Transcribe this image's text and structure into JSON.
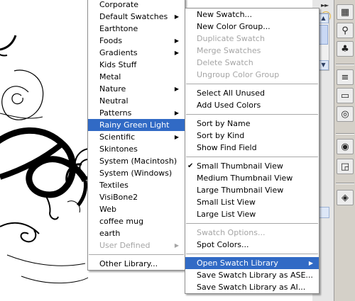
{
  "library_submenu": {
    "items": [
      {
        "label": "Corporate",
        "disabled": false,
        "submenu": false
      },
      {
        "label": "Default Swatches",
        "disabled": false,
        "submenu": true
      },
      {
        "label": "Earthtone",
        "disabled": false,
        "submenu": false
      },
      {
        "label": "Foods",
        "disabled": false,
        "submenu": true
      },
      {
        "label": "Gradients",
        "disabled": false,
        "submenu": true
      },
      {
        "label": "Kids Stuff",
        "disabled": false,
        "submenu": false
      },
      {
        "label": "Metal",
        "disabled": false,
        "submenu": false
      },
      {
        "label": "Nature",
        "disabled": false,
        "submenu": true
      },
      {
        "label": "Neutral",
        "disabled": false,
        "submenu": false
      },
      {
        "label": "Patterns",
        "disabled": false,
        "submenu": true
      },
      {
        "label": "Rainy Green Light",
        "disabled": false,
        "submenu": false,
        "selected": true
      },
      {
        "label": "Scientific",
        "disabled": false,
        "submenu": true
      },
      {
        "label": "Skintones",
        "disabled": false,
        "submenu": false
      },
      {
        "label": "System (Macintosh)",
        "disabled": false,
        "submenu": false
      },
      {
        "label": "System (Windows)",
        "disabled": false,
        "submenu": false
      },
      {
        "label": "Textiles",
        "disabled": false,
        "submenu": false
      },
      {
        "label": "VisiBone2",
        "disabled": false,
        "submenu": false
      },
      {
        "label": "Web",
        "disabled": false,
        "submenu": false
      },
      {
        "label": "coffee mug",
        "disabled": false,
        "submenu": false
      },
      {
        "label": "earth",
        "disabled": false,
        "submenu": false
      },
      {
        "label": "User Defined",
        "disabled": true,
        "submenu": true
      }
    ],
    "footer_item": {
      "label": "Other Library..."
    }
  },
  "panel_menu": {
    "groups": [
      [
        {
          "label": "New Swatch...",
          "disabled": false
        },
        {
          "label": "New Color Group...",
          "disabled": false
        },
        {
          "label": "Duplicate Swatch",
          "disabled": true
        },
        {
          "label": "Merge Swatches",
          "disabled": true
        },
        {
          "label": "Delete Swatch",
          "disabled": true
        },
        {
          "label": "Ungroup Color Group",
          "disabled": true
        }
      ],
      [
        {
          "label": "Select All Unused",
          "disabled": false
        },
        {
          "label": "Add Used Colors",
          "disabled": false
        }
      ],
      [
        {
          "label": "Sort by Name",
          "disabled": false
        },
        {
          "label": "Sort by Kind",
          "disabled": false
        },
        {
          "label": "Show Find Field",
          "disabled": false
        }
      ],
      [
        {
          "label": "Small Thumbnail View",
          "disabled": false,
          "checked": true
        },
        {
          "label": "Medium Thumbnail View",
          "disabled": false
        },
        {
          "label": "Large Thumbnail View",
          "disabled": false
        },
        {
          "label": "Small List View",
          "disabled": false
        },
        {
          "label": "Large List View",
          "disabled": false
        }
      ],
      [
        {
          "label": "Swatch Options...",
          "disabled": true
        },
        {
          "label": "Spot Colors...",
          "disabled": false
        }
      ],
      [
        {
          "label": "Open Swatch Library",
          "disabled": false,
          "submenu": true,
          "selected": true
        },
        {
          "label": "Save Swatch Library as ASE...",
          "disabled": false
        },
        {
          "label": "Save Swatch Library as AI...",
          "disabled": false
        }
      ]
    ]
  },
  "panel_strip": {
    "icons": [
      "swatches-icon",
      "brushes-icon",
      "symbols-icon",
      "stroke-icon",
      "gradient-icon",
      "transparency-icon",
      "appearance-icon",
      "graphic-styles-icon",
      "layers-icon"
    ],
    "glyphs": [
      "▦",
      "⚲",
      "♣",
      "≡",
      "▭",
      "◎",
      "◉",
      "◲",
      "◈"
    ]
  },
  "colors": {
    "selection": "#316ac5",
    "disabled_text": "#a5a5a5",
    "menu_border": "#8d8d8d"
  }
}
